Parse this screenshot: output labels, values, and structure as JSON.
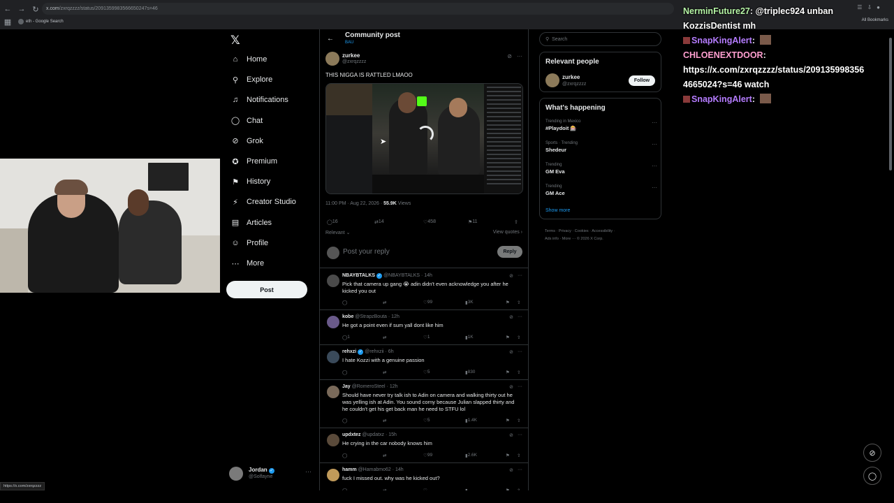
{
  "browser": {
    "url_main": "x.com",
    "url_rest": "/zxrqzzzz/status/2091359983566650247s=46",
    "bookmark_1": "eth - Google Search",
    "all_bookmarks": "All Bookmarks",
    "status_url": "https://x.com/zxrqzzzz"
  },
  "nav": {
    "items": [
      {
        "label": "Home",
        "icon": "home-icon",
        "glyph": "⌂"
      },
      {
        "label": "Explore",
        "icon": "search-icon",
        "glyph": "⚲"
      },
      {
        "label": "Notifications",
        "icon": "bell-icon",
        "glyph": "♫"
      },
      {
        "label": "Chat",
        "icon": "chat-icon",
        "glyph": "◯"
      },
      {
        "label": "Grok",
        "icon": "grok-icon",
        "glyph": "⊘"
      },
      {
        "label": "Premium",
        "icon": "premium-icon",
        "glyph": "✪"
      },
      {
        "label": "History",
        "icon": "bookmark-icon",
        "glyph": "⚑"
      },
      {
        "label": "Creator Studio",
        "icon": "creator-icon",
        "glyph": "⚡"
      },
      {
        "label": "Articles",
        "icon": "articles-icon",
        "glyph": "▤"
      },
      {
        "label": "Profile",
        "icon": "profile-icon",
        "glyph": "☺"
      },
      {
        "label": "More",
        "icon": "more-icon",
        "glyph": "⋯"
      }
    ],
    "post_label": "Post",
    "account_name": "Jordan",
    "account_handle": "@Solfayne"
  },
  "feed": {
    "title": "Community post",
    "subtitle": "BAU",
    "main_post": {
      "name": "zurkee",
      "handle": "@zxrqzzzz",
      "text": "THIS NIGGA IS RATTLED LMAOO",
      "time": "11:00 PM · Aug 22, 2026 · ",
      "views": "55.9K",
      "views_label": " Views",
      "replies": "16",
      "reposts": "14",
      "likes": "458",
      "bookmarks": "11",
      "sort": "Relevant",
      "view_quotes": "View quotes"
    },
    "reply_placeholder": "Post your reply",
    "reply_button": "Reply",
    "replies": [
      {
        "name": "NBAYBTALKS",
        "verified": true,
        "handle": "@NBAYBTALKS",
        "time": "· 14h",
        "text": "Pick that camera up gang 😭 adin didn't even acknowledge you after he kicked you out",
        "replies": "",
        "reposts": "",
        "likes": "99",
        "views": "3K"
      },
      {
        "name": "kobe",
        "verified": false,
        "handle": "@StrapzBouta",
        "time": "· 12h",
        "text": "He got a point even if sum yall dont like him",
        "replies": "1",
        "reposts": "",
        "likes": "1",
        "views": "1K"
      },
      {
        "name": "rehxzi",
        "verified": true,
        "handle": "@rehxzii",
        "time": "· 6h",
        "text": "I hate Kozzi with a genuine passion",
        "replies": "",
        "reposts": "",
        "likes": "5",
        "views": "830"
      },
      {
        "name": "Jay",
        "verified": false,
        "handle": "@RomeroSteel",
        "time": "· 12h",
        "text": "Should have never try talk ish to Adin on camera and walking thirty out he was yelling ish at Adin. You sound corny because Julian slapped thirty and he couldn't get his get back man he need to STFU lol",
        "replies": "",
        "reposts": "",
        "likes": "5",
        "views": "1.4K"
      },
      {
        "name": "updxtez",
        "verified": false,
        "handle": "@updatxz",
        "time": "· 15h",
        "text": "He crying in the car nobody knows him",
        "replies": "",
        "reposts": "",
        "likes": "99",
        "views": "2.6K"
      },
      {
        "name": "hamm",
        "verified": false,
        "handle": "@Hamabmo62",
        "time": "· 14h",
        "text": "fuck I missed out. why was he kicked out?",
        "replies": "",
        "reposts": "",
        "likes": "",
        "views": ""
      }
    ]
  },
  "sidebar": {
    "search_placeholder": "Search",
    "relevant_title": "Relevant people",
    "person_name": "zurkee",
    "person_handle": "@zxrqzzzz",
    "follow_label": "Follow",
    "happening_title": "What's happening",
    "trends": [
      {
        "context": "Trending in Mexico",
        "name": "#Playdoit 🎰"
      },
      {
        "context": "Sports · Trending",
        "name": "Shedeur"
      },
      {
        "context": "Trending",
        "name": "GM Eva"
      },
      {
        "context": "Trending",
        "name": "GM Ace"
      }
    ],
    "show_more": "Show more",
    "footer_line1": "Terms · Privacy · Cookies · Accessibility ·",
    "footer_line2": "Ads info · More ··· © 2026 X Corp."
  },
  "stream_chat": [
    {
      "user": "NerminFuture27",
      "color": "#b6f5a6",
      "sep": ": ",
      "msg": "@triplec924 unban",
      "badge": false,
      "emote": false
    },
    {
      "user": "KozzisDentist",
      "color": "#ffffff",
      "sep": " ",
      "msg": "mh",
      "badge": false,
      "emote": false
    },
    {
      "user": "SnapKingAlert",
      "color": "#b57cff",
      "sep": ": ",
      "msg": "",
      "badge": true,
      "emote": true
    },
    {
      "user": "CHLOENEXTDOOR",
      "color": "#ff9fd0",
      "sep": ":",
      "msg": "",
      "badge": false,
      "emote": false
    },
    {
      "user": "",
      "color": "#ffffff",
      "sep": "",
      "msg": "https://x.com/zxrqzzzz/status/209135998356",
      "badge": false,
      "emote": false
    },
    {
      "user": "",
      "color": "#ffffff",
      "sep": "",
      "msg": "4665024?s=46 watch",
      "badge": false,
      "emote": false
    },
    {
      "user": "SnapKingAlert",
      "color": "#b57cff",
      "sep": ": ",
      "msg": "",
      "badge": true,
      "emote": true
    }
  ]
}
